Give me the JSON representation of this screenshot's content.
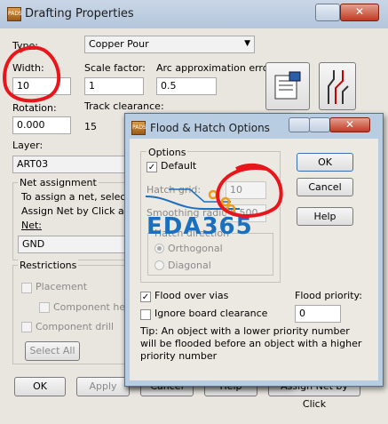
{
  "main": {
    "title": "Drafting Properties",
    "app_icon_text": "PADS",
    "type_label": "Type:",
    "type_value": "Copper Pour",
    "width_label": "Width:",
    "width_value": "10",
    "scale_label": "Scale factor:",
    "scale_value": "1",
    "arc_label": "Arc approximation error:",
    "arc_value": "0.5",
    "rotation_label": "Rotation:",
    "rotation_value": "0.000",
    "track_clearance_label": "Track clearance:",
    "track_clearance_value": "15",
    "layer_label": "Layer:",
    "layer_value": "ART03",
    "net_assignment_label": "Net assignment",
    "net_text_1": "To assign a net, select a",
    "net_text_2": "Assign Net by Click and t",
    "net_label": "Net:",
    "net_value": "GND",
    "restrictions_label": "Restrictions",
    "placement_label": "Placement",
    "component_height_label": "Component heigh",
    "component_drill_label": "Component drill",
    "select_all_label": "Select All",
    "ok_label": "OK",
    "apply_label": "Apply",
    "cancel_label": "Cancel",
    "help_label": "Help",
    "assign_net_label": "Assign Net by Click"
  },
  "flood": {
    "title": "Flood & Hatch Options",
    "app_icon_text": "PADS",
    "options_label": "Options",
    "default_label": "Default",
    "hatch_grid_label": "Hatch grid:",
    "hatch_grid_value": "10",
    "smoothing_label": "Smoothing radius:",
    "smoothing_value": "0.500",
    "hatch_direction_label": "Hatch direction",
    "orthogonal_label": "Orthogonal",
    "diagonal_label": "Diagonal",
    "flood_over_vias_label": "Flood over vias",
    "ignore_clearance_label": "Ignore board clearance",
    "flood_priority_label": "Flood priority:",
    "flood_priority_value": "0",
    "tip_text": "Tip: An object with a lower priority number will be flooded before an object with a higher priority number",
    "ok_label": "OK",
    "cancel_label": "Cancel",
    "help_label": "Help"
  },
  "watermark": "EDA365",
  "colors": {
    "annotation_red": "#e8161b",
    "watermark_blue": "#1b6fbf"
  }
}
